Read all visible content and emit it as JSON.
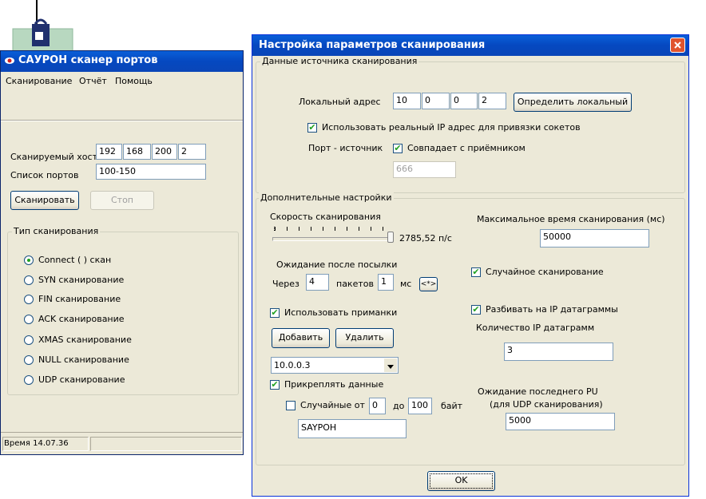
{
  "main_window": {
    "title": "САУРОН  сканер портов",
    "menu": [
      "Сканирование",
      "Отчёт",
      "Помощь"
    ],
    "host_label": "Сканируемый хост",
    "host": [
      "192",
      "168",
      "200",
      "2"
    ],
    "ports_label": "Список портов",
    "ports": "100-150",
    "scan_button": "Сканировать",
    "stop_button": "Стоп",
    "scan_type_group": "Тип сканирования",
    "scan_types": [
      "Connect ( ) скан",
      "SYN сканирование",
      "FIN сканирование",
      "ACK сканирование",
      "XMAS сканирование",
      "NULL сканирование",
      "UDP сканирование"
    ],
    "selected_scan_type": 0,
    "status_time": "Время 14.07.36"
  },
  "dialog": {
    "title": "Настройка параметров сканирования",
    "source_group": "Данные источника сканирования",
    "local_address_label": "Локальный адрес",
    "local_address": [
      "10",
      "0",
      "0",
      "2"
    ],
    "detect_local_button": "Определить локальный",
    "use_real_ip_label": "Использовать реальный IP адрес для привязки сокетов",
    "use_real_ip_checked": true,
    "source_port_label": "Порт - источник",
    "same_as_receiver_label": "Совпадает с приёмником",
    "same_as_receiver_checked": true,
    "source_port_value": "666",
    "extra_group": "Дополнительные настройки",
    "speed_label": "Скорость сканирования",
    "speed_value": "2785,52 п/с",
    "speed_slider_fraction": 1.0,
    "max_time_label": "Максимальное время сканирования (мс)",
    "max_time": "50000",
    "wait_after_send_label": "Ожидание после посылки",
    "through_label": "Через",
    "packets_count": "4",
    "packets_label": "пакетов",
    "ms_count": "1",
    "ms_label": "мс",
    "small_button": "<*>",
    "random_scan_label": "Случайное сканирование",
    "random_scan_checked": true,
    "use_decoys_label": "Использовать приманки",
    "use_decoys_checked": true,
    "split_ip_label": "Разбивать на IP датаграммы",
    "split_ip_checked": true,
    "ip_count_label": "Количество IP датаграмм",
    "ip_count": "3",
    "add_button": "Добавить",
    "delete_button": "Удалить",
    "decoy_selected": "10.0.0.3",
    "attach_data_label": "Прикреплять данные",
    "attach_data_checked": true,
    "random_from_label": "Случайные от",
    "random_checked": false,
    "random_from": "0",
    "to_label": "до",
    "random_to": "100",
    "bytes_label": "байт",
    "data_text": "SAYPOH",
    "wait_last_pu_label": "Ожидание последнего PU",
    "udp_scan_label": "(для UDP сканирования)",
    "wait_last_pu": "5000",
    "ok_button": "OK"
  }
}
